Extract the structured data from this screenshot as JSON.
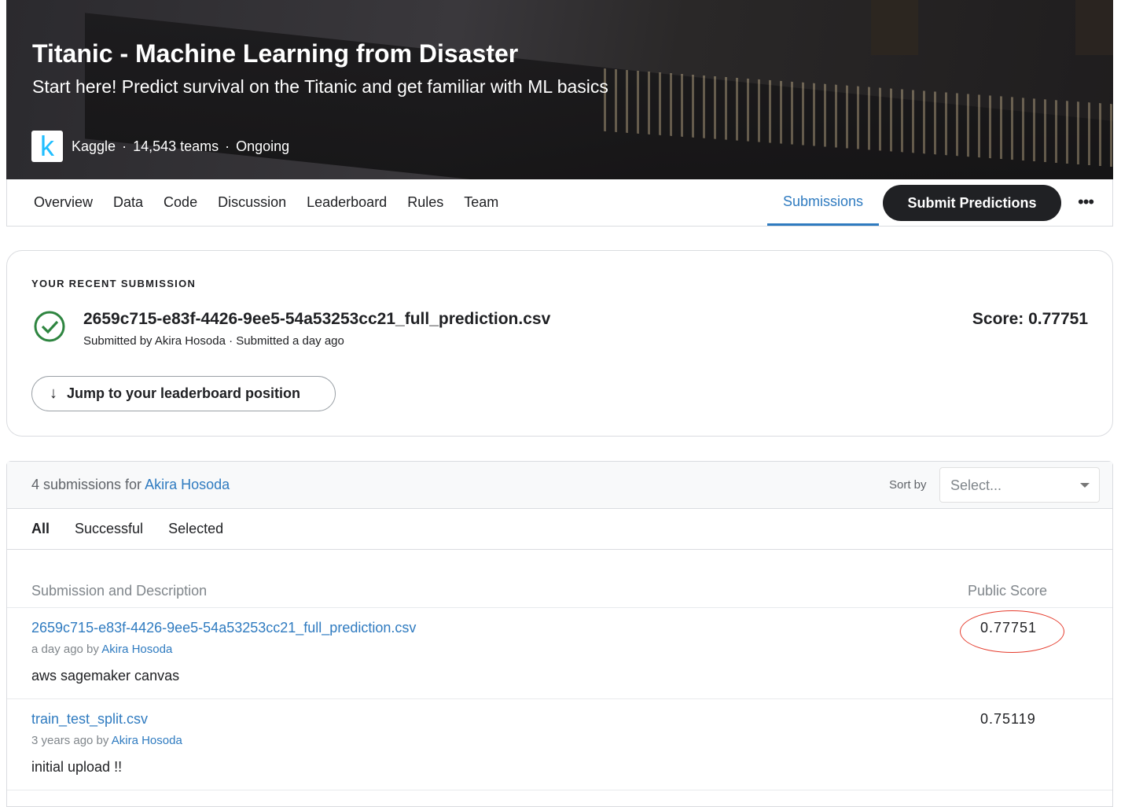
{
  "hero": {
    "title": "Titanic - Machine Learning from Disaster",
    "subtitle": "Start here! Predict survival on the Titanic and get familiar with ML basics",
    "logo": "k",
    "host": "Kaggle",
    "teams": "14,543 teams",
    "status": "Ongoing",
    "sep": "·"
  },
  "nav": {
    "tabs": [
      "Overview",
      "Data",
      "Code",
      "Discussion",
      "Leaderboard",
      "Rules",
      "Team"
    ],
    "active": "Submissions",
    "submit": "Submit Predictions",
    "more": "•••"
  },
  "recent": {
    "label": "YOUR RECENT SUBMISSION",
    "file": "2659c715-e83f-4426-9ee5-54a53253cc21_full_prediction.csv",
    "by": "Submitted by Akira Hosoda · Submitted a day ago",
    "score": "Score: 0.77751",
    "jump": "Jump to your leaderboard position"
  },
  "list": {
    "count": "4 submissions for",
    "user": "Akira Hosoda",
    "sort_label": "Sort by",
    "sort_placeholder": "Select...",
    "filters": [
      "All",
      "Successful",
      "Selected"
    ],
    "col_submission": "Submission and Description",
    "col_score": "Public Score",
    "rows": [
      {
        "file": "2659c715-e83f-4426-9ee5-54a53253cc21_full_prediction.csv",
        "when": "a day ago by",
        "user": "Akira Hosoda",
        "desc": "aws sagemaker canvas",
        "score": "0.77751"
      },
      {
        "file": "train_test_split.csv",
        "when": "3 years ago by",
        "user": "Akira Hosoda",
        "desc": "initial upload !!",
        "score": "0.75119"
      }
    ]
  },
  "colors": {
    "accent": "#2f7bc0",
    "success": "#2e8540",
    "highlight": "#e53b2c"
  }
}
